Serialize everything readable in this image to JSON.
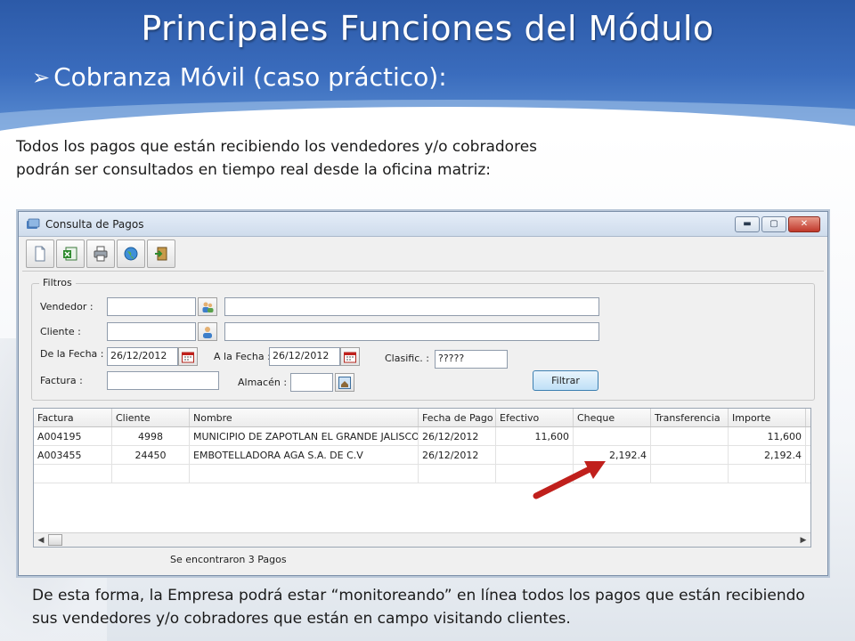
{
  "slide": {
    "title": "Principales Funciones del Módulo",
    "subtitle_bullet": "➢",
    "subtitle": "Cobranza Móvil (caso práctico):",
    "intro": "Todos los pagos que están recibiendo los vendedores y/o cobradores podrán ser consultados en tiempo real desde la oficina matriz:",
    "outro": "De esta forma, la Empresa podrá estar “monitoreando” en línea todos los pagos que están recibiendo sus vendedores y/o cobradores que están en campo visitando clientes."
  },
  "window": {
    "title": "Consulta de Pagos",
    "controls": {
      "minimize": "▬",
      "maximize": "▢",
      "close": "✕"
    },
    "toolbar_icons": [
      "new-document-icon",
      "excel-export-icon",
      "print-icon",
      "globe-icon",
      "exit-icon"
    ]
  },
  "filtros": {
    "legend": "Filtros",
    "vendedor_label": "Vendedor :",
    "vendedor_code": "",
    "vendedor_name": "",
    "cliente_label": "Cliente :",
    "cliente_code": "",
    "cliente_name": "",
    "de_fecha_label": "De la Fecha :",
    "de_fecha_value": "26/12/2012",
    "a_fecha_label": "A la Fecha :",
    "a_fecha_value": "26/12/2012",
    "clasific_label": "Clasific. :",
    "clasific_value": "?????",
    "factura_label": "Factura :",
    "factura_value": "",
    "almacen_label": "Almacén :",
    "almacen_value": "",
    "filtrar_label": "Filtrar"
  },
  "grid": {
    "columns": [
      "Factura",
      "Cliente",
      "Nombre",
      "Fecha de Pago",
      "Efectivo",
      "Cheque",
      "Transferencia",
      "Importe"
    ],
    "rows": [
      {
        "factura": "A004195",
        "cliente": "4998",
        "nombre": "MUNICIPIO DE ZAPOTLAN EL GRANDE JALISCO",
        "fecha": "26/12/2012",
        "efectivo": "11,600",
        "cheque": "",
        "transferencia": "",
        "importe": "11,600"
      },
      {
        "factura": "A003455",
        "cliente": "24450",
        "nombre": "EMBOTELLADORA AGA S.A. DE C.V",
        "fecha": "26/12/2012",
        "efectivo": "",
        "cheque": "2,192.4",
        "transferencia": "",
        "importe": "2,192.4"
      }
    ]
  },
  "status": {
    "text": "Se encontraron 3 Pagos"
  },
  "colors": {
    "header_blue": "#2c5aa8",
    "annotation_red": "#c0201c",
    "button_blue": "#3c7fb1"
  }
}
